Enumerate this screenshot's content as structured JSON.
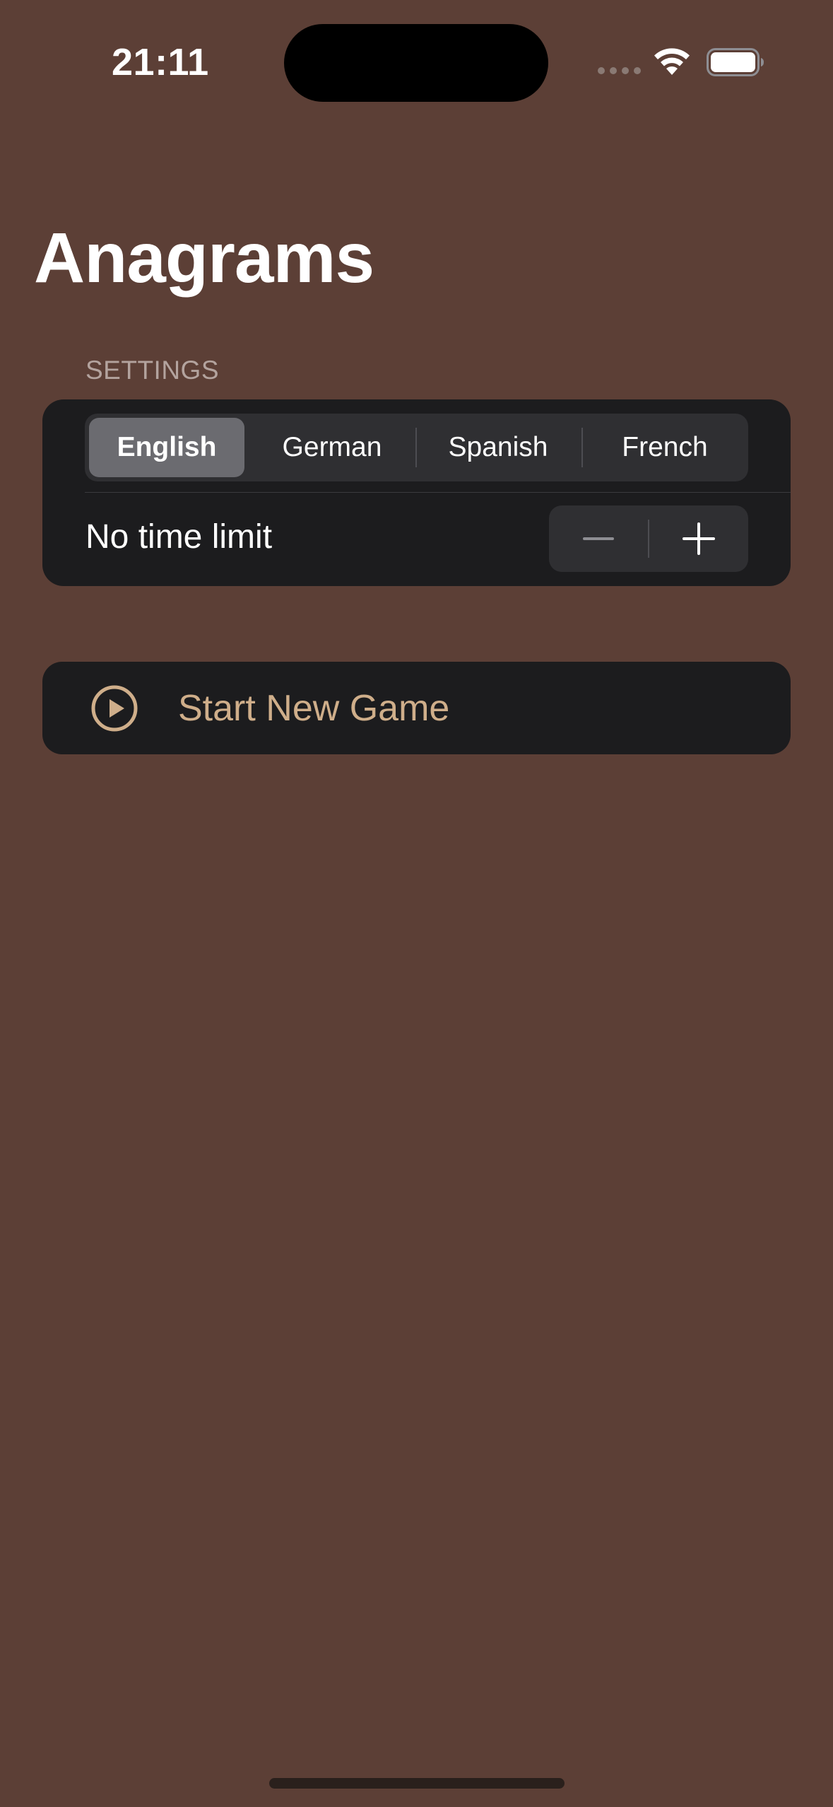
{
  "status_bar": {
    "time": "21:11",
    "icons": [
      "signal-dots-icon",
      "wifi-icon",
      "battery-icon"
    ]
  },
  "title": "Anagrams",
  "settings": {
    "header": "SETTINGS",
    "languages": [
      "English",
      "German",
      "Spanish",
      "French"
    ],
    "selected_language": "English",
    "time_limit_label": "No time limit",
    "stepper": {
      "minus_icon": "minus-icon",
      "plus_icon": "plus-icon"
    }
  },
  "start_button": {
    "label": "Start New Game",
    "icon": "play-circle-icon"
  },
  "colors": {
    "background": "#5c3f36",
    "card": "#1c1c1e",
    "accent": "#cfae8a",
    "secondary_text": "#b3a39e"
  }
}
